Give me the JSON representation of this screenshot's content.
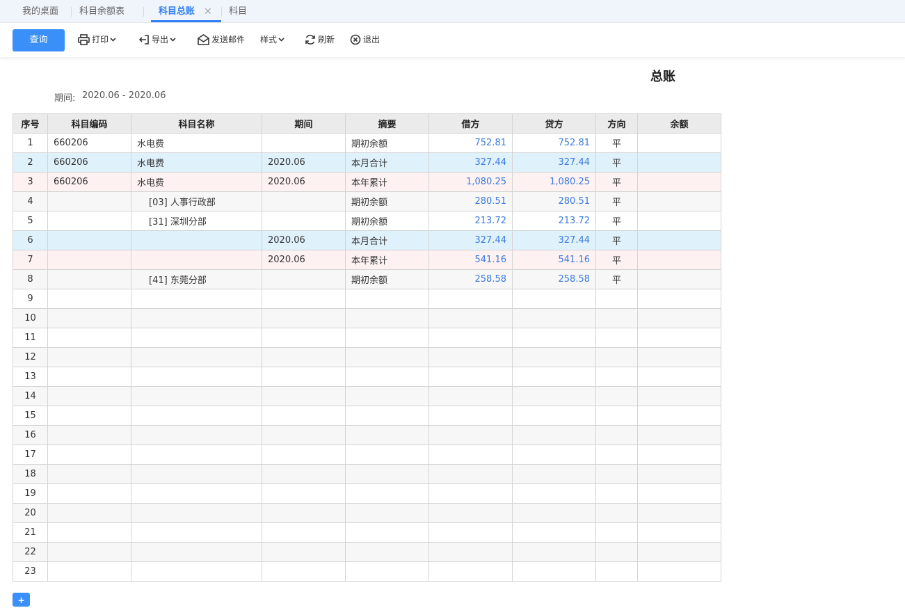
{
  "tabs": [
    {
      "label": "我的桌面"
    },
    {
      "label": "科目余额表"
    },
    {
      "label": "科目总账",
      "active": true
    },
    {
      "label": "科目"
    }
  ],
  "tab_close_glyph": "✕",
  "toolbar": {
    "query_label": "查询",
    "print_label": "打印",
    "export_label": "导出",
    "email_label": "发送邮件",
    "style_label": "样式",
    "refresh_label": "刷新",
    "exit_label": "退出"
  },
  "report": {
    "title": "总账",
    "period_label": "期间:",
    "period_value": "2020.06 - 2020.06"
  },
  "table": {
    "headers": [
      "序号",
      "科目编码",
      "科目名称",
      "期间",
      "摘要",
      "借方",
      "贷方",
      "方向",
      "余额"
    ],
    "rows": [
      {
        "no": "1",
        "code": "660206",
        "name": "水电费",
        "period": "",
        "summary": "期初余额",
        "debit": "752.81",
        "credit": "752.81",
        "dir": "平",
        "balance": "",
        "style": "white",
        "indent": false
      },
      {
        "no": "2",
        "code": "660206",
        "name": "水电费",
        "period": "2020.06",
        "summary": "本月合计",
        "debit": "327.44",
        "credit": "327.44",
        "dir": "平",
        "balance": "",
        "style": "blue",
        "indent": false
      },
      {
        "no": "3",
        "code": "660206",
        "name": "水电费",
        "period": "2020.06",
        "summary": "本年累计",
        "debit": "1,080.25",
        "credit": "1,080.25",
        "dir": "平",
        "balance": "",
        "style": "pink",
        "indent": false
      },
      {
        "no": "4",
        "code": "",
        "name": "[03] 人事行政部",
        "period": "",
        "summary": "期初余额",
        "debit": "280.51",
        "credit": "280.51",
        "dir": "平",
        "balance": "",
        "style": "gray",
        "indent": true
      },
      {
        "no": "5",
        "code": "",
        "name": "[31] 深圳分部",
        "period": "",
        "summary": "期初余额",
        "debit": "213.72",
        "credit": "213.72",
        "dir": "平",
        "balance": "",
        "style": "white",
        "indent": true
      },
      {
        "no": "6",
        "code": "",
        "name": "",
        "period": "2020.06",
        "summary": "本月合计",
        "debit": "327.44",
        "credit": "327.44",
        "dir": "平",
        "balance": "",
        "style": "blue",
        "indent": false
      },
      {
        "no": "7",
        "code": "",
        "name": "",
        "period": "2020.06",
        "summary": "本年累计",
        "debit": "541.16",
        "credit": "541.16",
        "dir": "平",
        "balance": "",
        "style": "pink",
        "indent": false
      },
      {
        "no": "8",
        "code": "",
        "name": "[41] 东莞分部",
        "period": "",
        "summary": "期初余额",
        "debit": "258.58",
        "credit": "258.58",
        "dir": "平",
        "balance": "",
        "style": "gray",
        "indent": true
      },
      {
        "no": "9",
        "style": "white"
      },
      {
        "no": "10",
        "style": "gray"
      },
      {
        "no": "11",
        "style": "white"
      },
      {
        "no": "12",
        "style": "gray"
      },
      {
        "no": "13",
        "style": "white"
      },
      {
        "no": "14",
        "style": "gray"
      },
      {
        "no": "15",
        "style": "white"
      },
      {
        "no": "16",
        "style": "gray"
      },
      {
        "no": "17",
        "style": "white"
      },
      {
        "no": "18",
        "style": "gray"
      },
      {
        "no": "19",
        "style": "white"
      },
      {
        "no": "20",
        "style": "gray"
      },
      {
        "no": "21",
        "style": "white"
      },
      {
        "no": "22",
        "style": "gray"
      },
      {
        "no": "23",
        "style": "white"
      }
    ]
  },
  "footer": {
    "corner_glyph": "+"
  },
  "colors": {
    "accent": "#3b8ff8",
    "amount_text": "#3a7be0",
    "row_month_total": "#dff1fb",
    "row_year_total": "#fdf1f1"
  }
}
